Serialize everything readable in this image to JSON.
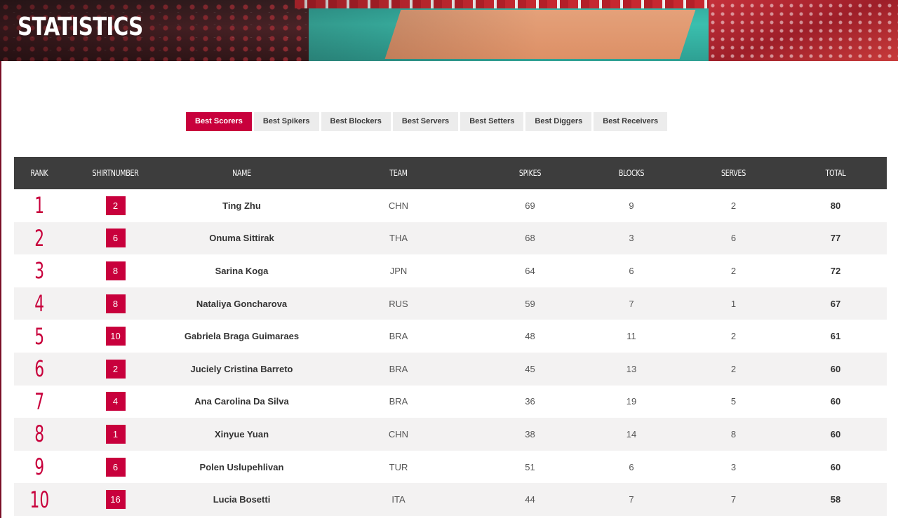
{
  "page": {
    "title": "STATISTICS"
  },
  "colors": {
    "accent": "#c8003c",
    "header_bg": "#3d3d3d",
    "tab_bg": "#ececec",
    "row_alt": "#f3f2f2"
  },
  "tabs": [
    {
      "label": "Best Scorers",
      "active": true
    },
    {
      "label": "Best Spikers",
      "active": false
    },
    {
      "label": "Best Blockers",
      "active": false
    },
    {
      "label": "Best Servers",
      "active": false
    },
    {
      "label": "Best Setters",
      "active": false
    },
    {
      "label": "Best Diggers",
      "active": false
    },
    {
      "label": "Best Receivers",
      "active": false
    }
  ],
  "table": {
    "columns": [
      "RANK",
      "SHIRTNUMBER",
      "NAME",
      "TEAM",
      "SPIKES",
      "BLOCKS",
      "SERVES",
      "TOTAL"
    ],
    "rows": [
      {
        "rank": "1",
        "shirt": "2",
        "name": "Ting Zhu",
        "team": "CHN",
        "spikes": "69",
        "blocks": "9",
        "serves": "2",
        "total": "80"
      },
      {
        "rank": "2",
        "shirt": "6",
        "name": "Onuma Sittirak",
        "team": "THA",
        "spikes": "68",
        "blocks": "3",
        "serves": "6",
        "total": "77"
      },
      {
        "rank": "3",
        "shirt": "8",
        "name": "Sarina Koga",
        "team": "JPN",
        "spikes": "64",
        "blocks": "6",
        "serves": "2",
        "total": "72"
      },
      {
        "rank": "4",
        "shirt": "8",
        "name": "Nataliya Goncharova",
        "team": "RUS",
        "spikes": "59",
        "blocks": "7",
        "serves": "1",
        "total": "67"
      },
      {
        "rank": "5",
        "shirt": "10",
        "name": "Gabriela Braga Guimaraes",
        "team": "BRA",
        "spikes": "48",
        "blocks": "11",
        "serves": "2",
        "total": "61"
      },
      {
        "rank": "6",
        "shirt": "2",
        "name": "Juciely Cristina Barreto",
        "team": "BRA",
        "spikes": "45",
        "blocks": "13",
        "serves": "2",
        "total": "60"
      },
      {
        "rank": "7",
        "shirt": "4",
        "name": "Ana Carolina Da Silva",
        "team": "BRA",
        "spikes": "36",
        "blocks": "19",
        "serves": "5",
        "total": "60"
      },
      {
        "rank": "8",
        "shirt": "1",
        "name": "Xinyue Yuan",
        "team": "CHN",
        "spikes": "38",
        "blocks": "14",
        "serves": "8",
        "total": "60"
      },
      {
        "rank": "9",
        "shirt": "6",
        "name": "Polen Uslupehlivan",
        "team": "TUR",
        "spikes": "51",
        "blocks": "6",
        "serves": "3",
        "total": "60"
      },
      {
        "rank": "10",
        "shirt": "16",
        "name": "Lucia Bosetti",
        "team": "ITA",
        "spikes": "44",
        "blocks": "7",
        "serves": "7",
        "total": "58"
      }
    ]
  }
}
